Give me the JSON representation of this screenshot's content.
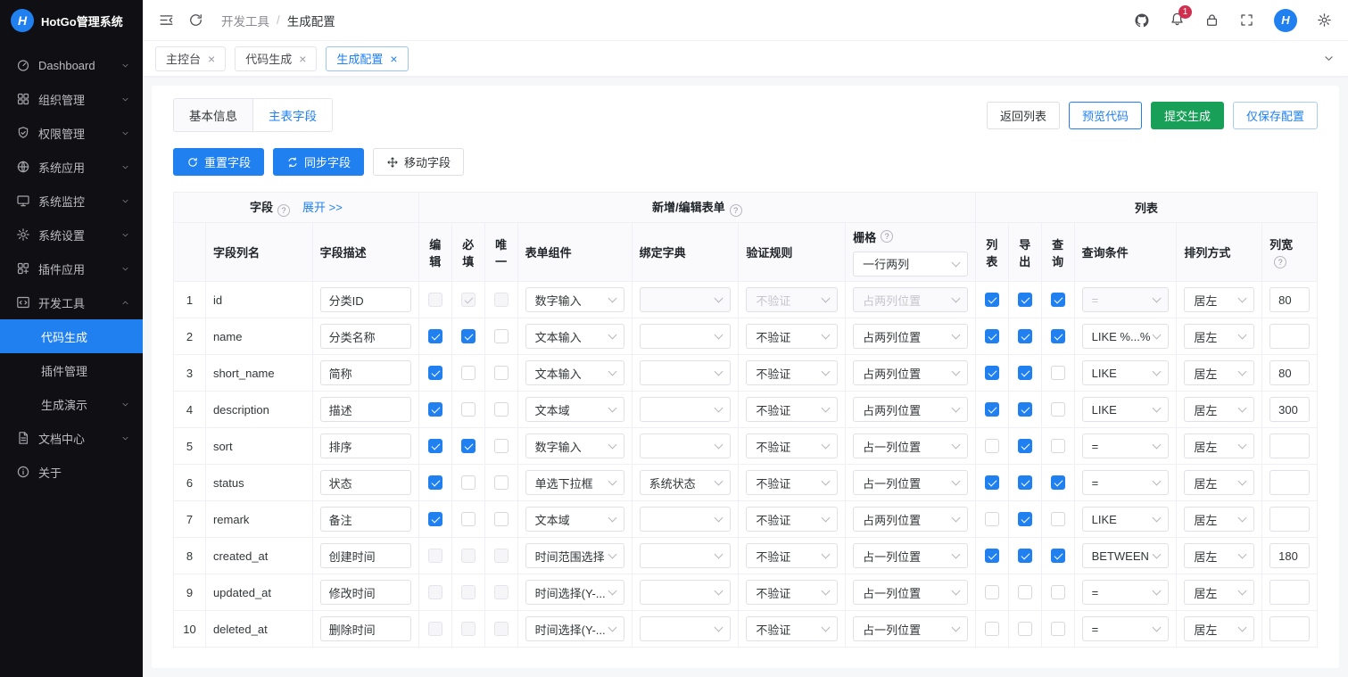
{
  "app": {
    "title": "HotGo管理系统",
    "logo_letter": "H"
  },
  "colors": {
    "accent": "#2080f0",
    "success": "#18a058",
    "danger": "#d03050",
    "sidebar_bg": "#101014"
  },
  "header": {
    "breadcrumb": [
      "开发工具",
      "生成配置"
    ],
    "notification_count": "1"
  },
  "nav_tabs": [
    {
      "id": "console",
      "label": "主控台",
      "active": false
    },
    {
      "id": "code-generate",
      "label": "代码生成",
      "active": false
    },
    {
      "id": "generate-config",
      "label": "生成配置",
      "active": true
    }
  ],
  "sidebar": {
    "items": [
      {
        "id": "dashboard",
        "label": "Dashboard",
        "icon": "dashboard-icon",
        "chevron": true
      },
      {
        "id": "organization",
        "label": "组织管理",
        "icon": "org-icon",
        "chevron": true
      },
      {
        "id": "permission",
        "label": "权限管理",
        "icon": "shield-icon",
        "chevron": true
      },
      {
        "id": "system-app",
        "label": "系统应用",
        "icon": "globe-icon",
        "chevron": true
      },
      {
        "id": "system-monitor",
        "label": "系统监控",
        "icon": "monitor-icon",
        "chevron": true
      },
      {
        "id": "system-settings",
        "label": "系统设置",
        "icon": "gear-icon",
        "chevron": true
      },
      {
        "id": "plugin-app",
        "label": "插件应用",
        "icon": "grid-icon",
        "chevron": true
      },
      {
        "id": "dev-tools",
        "label": "开发工具",
        "icon": "code-icon",
        "chevron": true,
        "expanded": true,
        "children": [
          {
            "id": "code-generate",
            "label": "代码生成",
            "active": true
          },
          {
            "id": "plugin-manage",
            "label": "插件管理"
          },
          {
            "id": "generate-demo",
            "label": "生成演示",
            "chevron": true
          }
        ]
      },
      {
        "id": "docs-center",
        "label": "文档中心",
        "icon": "document-icon",
        "chevron": true
      },
      {
        "id": "about",
        "label": "关于",
        "icon": "info-icon"
      }
    ]
  },
  "content": {
    "tabs": [
      "基本信息",
      "主表字段"
    ],
    "active_tab": "主表字段",
    "actions": {
      "back": "返回列表",
      "preview": "预览代码",
      "submit": "提交生成",
      "save": "仅保存配置"
    },
    "toolbar": {
      "reset": "重置字段",
      "sync": "同步字段",
      "move": "移动字段"
    },
    "table": {
      "group_field": "字段",
      "expand_link": "展开 >>",
      "group_form": "新增/编辑表单",
      "group_list": "列表",
      "columns": {
        "field_name": "字段列名",
        "field_desc": "字段描述",
        "edit": "编辑",
        "required": "必填",
        "unique": "唯一",
        "component": "表单组件",
        "dict": "绑定字典",
        "rule": "验证规则",
        "grid": "栅格",
        "grid_value": "一行两列",
        "list": "列表",
        "export": "导出",
        "query": "查询",
        "query_cond": "查询条件",
        "align": "排列方式",
        "width": "列宽"
      },
      "rows": [
        {
          "num": "1",
          "field": "id",
          "desc": "分类ID",
          "edit": "disabled",
          "required": "disabled-checked",
          "unique": "disabled",
          "component": "数字输入",
          "dict": "",
          "dict_disabled": true,
          "rule": "不验证",
          "rule_disabled": true,
          "grid": "占两列位置",
          "grid_disabled": true,
          "list": "checked",
          "export": "checked",
          "query": "checked",
          "query_cond": "=",
          "query_cond_disabled": true,
          "align": "居左",
          "width": "80"
        },
        {
          "num": "2",
          "field": "name",
          "desc": "分类名称",
          "edit": "checked",
          "required": "checked",
          "unique": "unchecked",
          "component": "文本输入",
          "dict": "",
          "rule": "不验证",
          "grid": "占两列位置",
          "list": "checked",
          "export": "checked",
          "query": "checked",
          "query_cond": "LIKE %...%",
          "align": "居左",
          "width": ""
        },
        {
          "num": "3",
          "field": "short_name",
          "desc": "简称",
          "edit": "checked",
          "required": "unchecked",
          "unique": "unchecked",
          "component": "文本输入",
          "dict": "",
          "rule": "不验证",
          "grid": "占两列位置",
          "list": "checked",
          "export": "checked",
          "query": "unchecked",
          "query_cond": "LIKE",
          "align": "居左",
          "width": "80"
        },
        {
          "num": "4",
          "field": "description",
          "desc": "描述",
          "edit": "checked",
          "required": "unchecked",
          "unique": "unchecked",
          "component": "文本域",
          "dict": "",
          "rule": "不验证",
          "grid": "占两列位置",
          "list": "checked",
          "export": "checked",
          "query": "unchecked",
          "query_cond": "LIKE",
          "align": "居左",
          "width": "300"
        },
        {
          "num": "5",
          "field": "sort",
          "desc": "排序",
          "edit": "checked",
          "required": "checked",
          "unique": "unchecked",
          "component": "数字输入",
          "dict": "",
          "rule": "不验证",
          "grid": "占一列位置",
          "list": "unchecked",
          "export": "checked",
          "query": "unchecked",
          "query_cond": "=",
          "align": "居左",
          "width": ""
        },
        {
          "num": "6",
          "field": "status",
          "desc": "状态",
          "edit": "checked",
          "required": "unchecked",
          "unique": "unchecked",
          "component": "单选下拉框",
          "dict": "系统状态",
          "rule": "不验证",
          "grid": "占一列位置",
          "list": "checked",
          "export": "checked",
          "query": "checked",
          "query_cond": "=",
          "align": "居左",
          "width": ""
        },
        {
          "num": "7",
          "field": "remark",
          "desc": "备注",
          "edit": "checked",
          "required": "unchecked",
          "unique": "unchecked",
          "component": "文本域",
          "dict": "",
          "rule": "不验证",
          "grid": "占两列位置",
          "list": "unchecked",
          "export": "checked",
          "query": "unchecked",
          "query_cond": "LIKE",
          "align": "居左",
          "width": ""
        },
        {
          "num": "8",
          "field": "created_at",
          "desc": "创建时间",
          "edit": "disabled",
          "required": "disabled",
          "unique": "disabled",
          "component": "时间范围选择",
          "dict": "",
          "rule": "不验证",
          "grid": "占一列位置",
          "list": "checked",
          "export": "checked",
          "query": "checked",
          "query_cond": "BETWEEN",
          "align": "居左",
          "width": "180"
        },
        {
          "num": "9",
          "field": "updated_at",
          "desc": "修改时间",
          "edit": "disabled",
          "required": "disabled",
          "unique": "disabled",
          "component": "时间选择(Y-...",
          "dict": "",
          "rule": "不验证",
          "grid": "占一列位置",
          "list": "unchecked",
          "export": "unchecked",
          "query": "unchecked",
          "query_cond": "=",
          "align": "居左",
          "width": ""
        },
        {
          "num": "10",
          "field": "deleted_at",
          "desc": "删除时间",
          "edit": "disabled",
          "required": "disabled",
          "unique": "disabled",
          "component": "时间选择(Y-...",
          "dict": "",
          "rule": "不验证",
          "grid": "占一列位置",
          "list": "unchecked",
          "export": "unchecked",
          "query": "unchecked",
          "query_cond": "=",
          "align": "居左",
          "width": ""
        }
      ]
    }
  }
}
